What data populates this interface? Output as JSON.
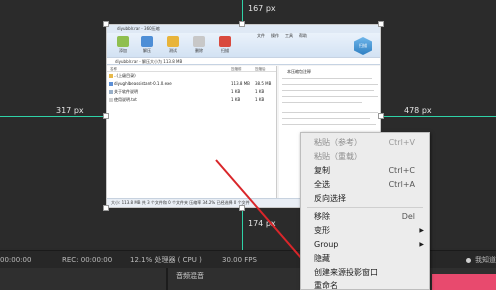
{
  "measurements": {
    "top": "167 px",
    "left": "317 px",
    "right": "478 px",
    "bottom": "174 px"
  },
  "archive_window": {
    "title": "diyubblr.rar - 360压缩",
    "toolbar": [
      "添加",
      "解压",
      "测试",
      "删除",
      "扫描"
    ],
    "top_menu": [
      "文件",
      "操作",
      "工具",
      "帮助"
    ],
    "badge": "扫描",
    "path": "diyubblr.rar - 解压大小为 113.8 MB",
    "columns": [
      "名称",
      "压缩前",
      "压缩后"
    ],
    "files": [
      {
        "name": "..(上级目录)",
        "size": "",
        "csize": ""
      },
      {
        "name": "diyughlbeassistant-0.1.0.exe",
        "size": "113.8 MB",
        "csize": "38.5 MB"
      },
      {
        "name": "关于软件说明",
        "size": "1 KB",
        "csize": "1 KB"
      },
      {
        "name": "使用说明.txt",
        "size": "1 KB",
        "csize": "1 KB"
      }
    ],
    "side_title": "本压缩包注释",
    "status": "大小: 113.8 MB 共 3 个文件和 0 个文件夹 压缩率 34.2% 已经选择 0 个文件"
  },
  "context_menu": {
    "items": [
      {
        "label": "粘贴（参考）",
        "shortcut": "Ctrl+V",
        "disabled": true
      },
      {
        "label": "粘贴（重载）",
        "shortcut": "",
        "disabled": true
      },
      {
        "label": "复制",
        "shortcut": "Ctrl+C",
        "disabled": false
      },
      {
        "label": "全选",
        "shortcut": "Ctrl+A",
        "disabled": false
      },
      {
        "label": "反向选择",
        "shortcut": "",
        "disabled": false
      },
      {
        "label": "移除",
        "shortcut": "Del",
        "disabled": false
      },
      {
        "label": "变形",
        "shortcut": "",
        "disabled": false,
        "submenu": true
      },
      {
        "label": "Group",
        "shortcut": "",
        "disabled": false,
        "submenu": true
      },
      {
        "label": "隐藏",
        "shortcut": "",
        "disabled": false
      },
      {
        "label": "创建来源投影窗口",
        "shortcut": "",
        "disabled": false
      },
      {
        "label": "重命名",
        "shortcut": "",
        "disabled": false
      }
    ]
  },
  "status_bar": {
    "live": "00:00:00",
    "rec": "REC: 00:00:00",
    "cpu": "12.1% 处理器 ( CPU )",
    "fps": "30.00 FPS",
    "stream": "我知道"
  },
  "bottom_panel": {
    "audio_mixer": "音频混音"
  },
  "colors": {
    "guide": "#2fd2a7",
    "arrow": "#d9262a",
    "accent_button": "#e84a6e"
  }
}
